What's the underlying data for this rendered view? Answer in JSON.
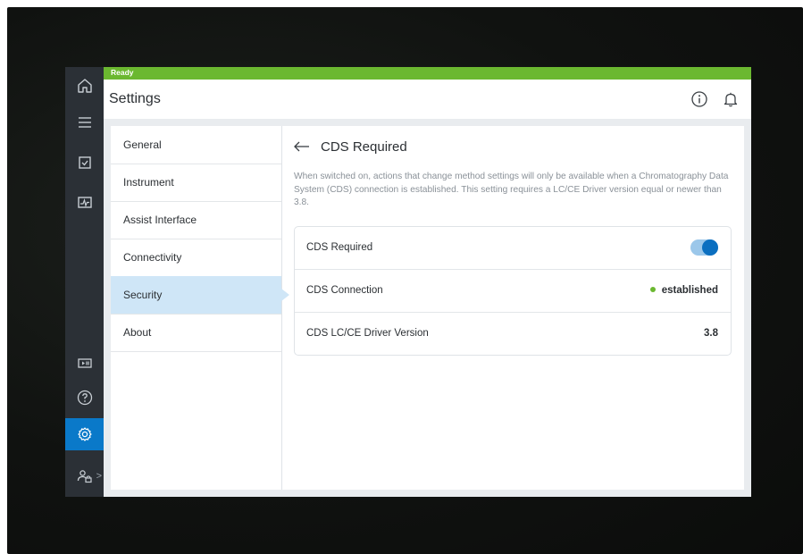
{
  "status": {
    "text": "Ready",
    "color": "#6bb830"
  },
  "header": {
    "title": "Settings",
    "info_icon": "info-icon",
    "bell_icon": "bell-icon"
  },
  "rail": {
    "items": [
      {
        "icon": "home-icon"
      },
      {
        "icon": "list-icon"
      },
      {
        "icon": "checkbox-icon"
      },
      {
        "icon": "monitor-icon"
      },
      {
        "icon": "play-pause-icon"
      },
      {
        "icon": "help-icon"
      },
      {
        "icon": "gear-icon",
        "active": true
      },
      {
        "icon": "user-lock-icon"
      }
    ],
    "chevron": ">"
  },
  "nav": {
    "items": [
      {
        "label": "General"
      },
      {
        "label": "Instrument"
      },
      {
        "label": "Assist Interface"
      },
      {
        "label": "Connectivity"
      },
      {
        "label": "Security",
        "active": true
      },
      {
        "label": "About"
      }
    ]
  },
  "detail": {
    "back_icon": "arrow-left-icon",
    "title": "CDS Required",
    "description": "When switched on, actions that change method settings will only be available when a Chromatography Data System (CDS) connection is established. This setting requires a LC/CE Driver version equal or newer than 3.8.",
    "rows": [
      {
        "label": "CDS Required",
        "toggle_on": true
      },
      {
        "label": "CDS Connection",
        "value": "established",
        "status_color": "#6bb830"
      },
      {
        "label": "CDS LC/CE Driver Version",
        "value": "3.8"
      }
    ]
  },
  "colors": {
    "accent": "#0a79c9",
    "rail": "#2b3036",
    "selected_nav": "#cfe6f7"
  }
}
